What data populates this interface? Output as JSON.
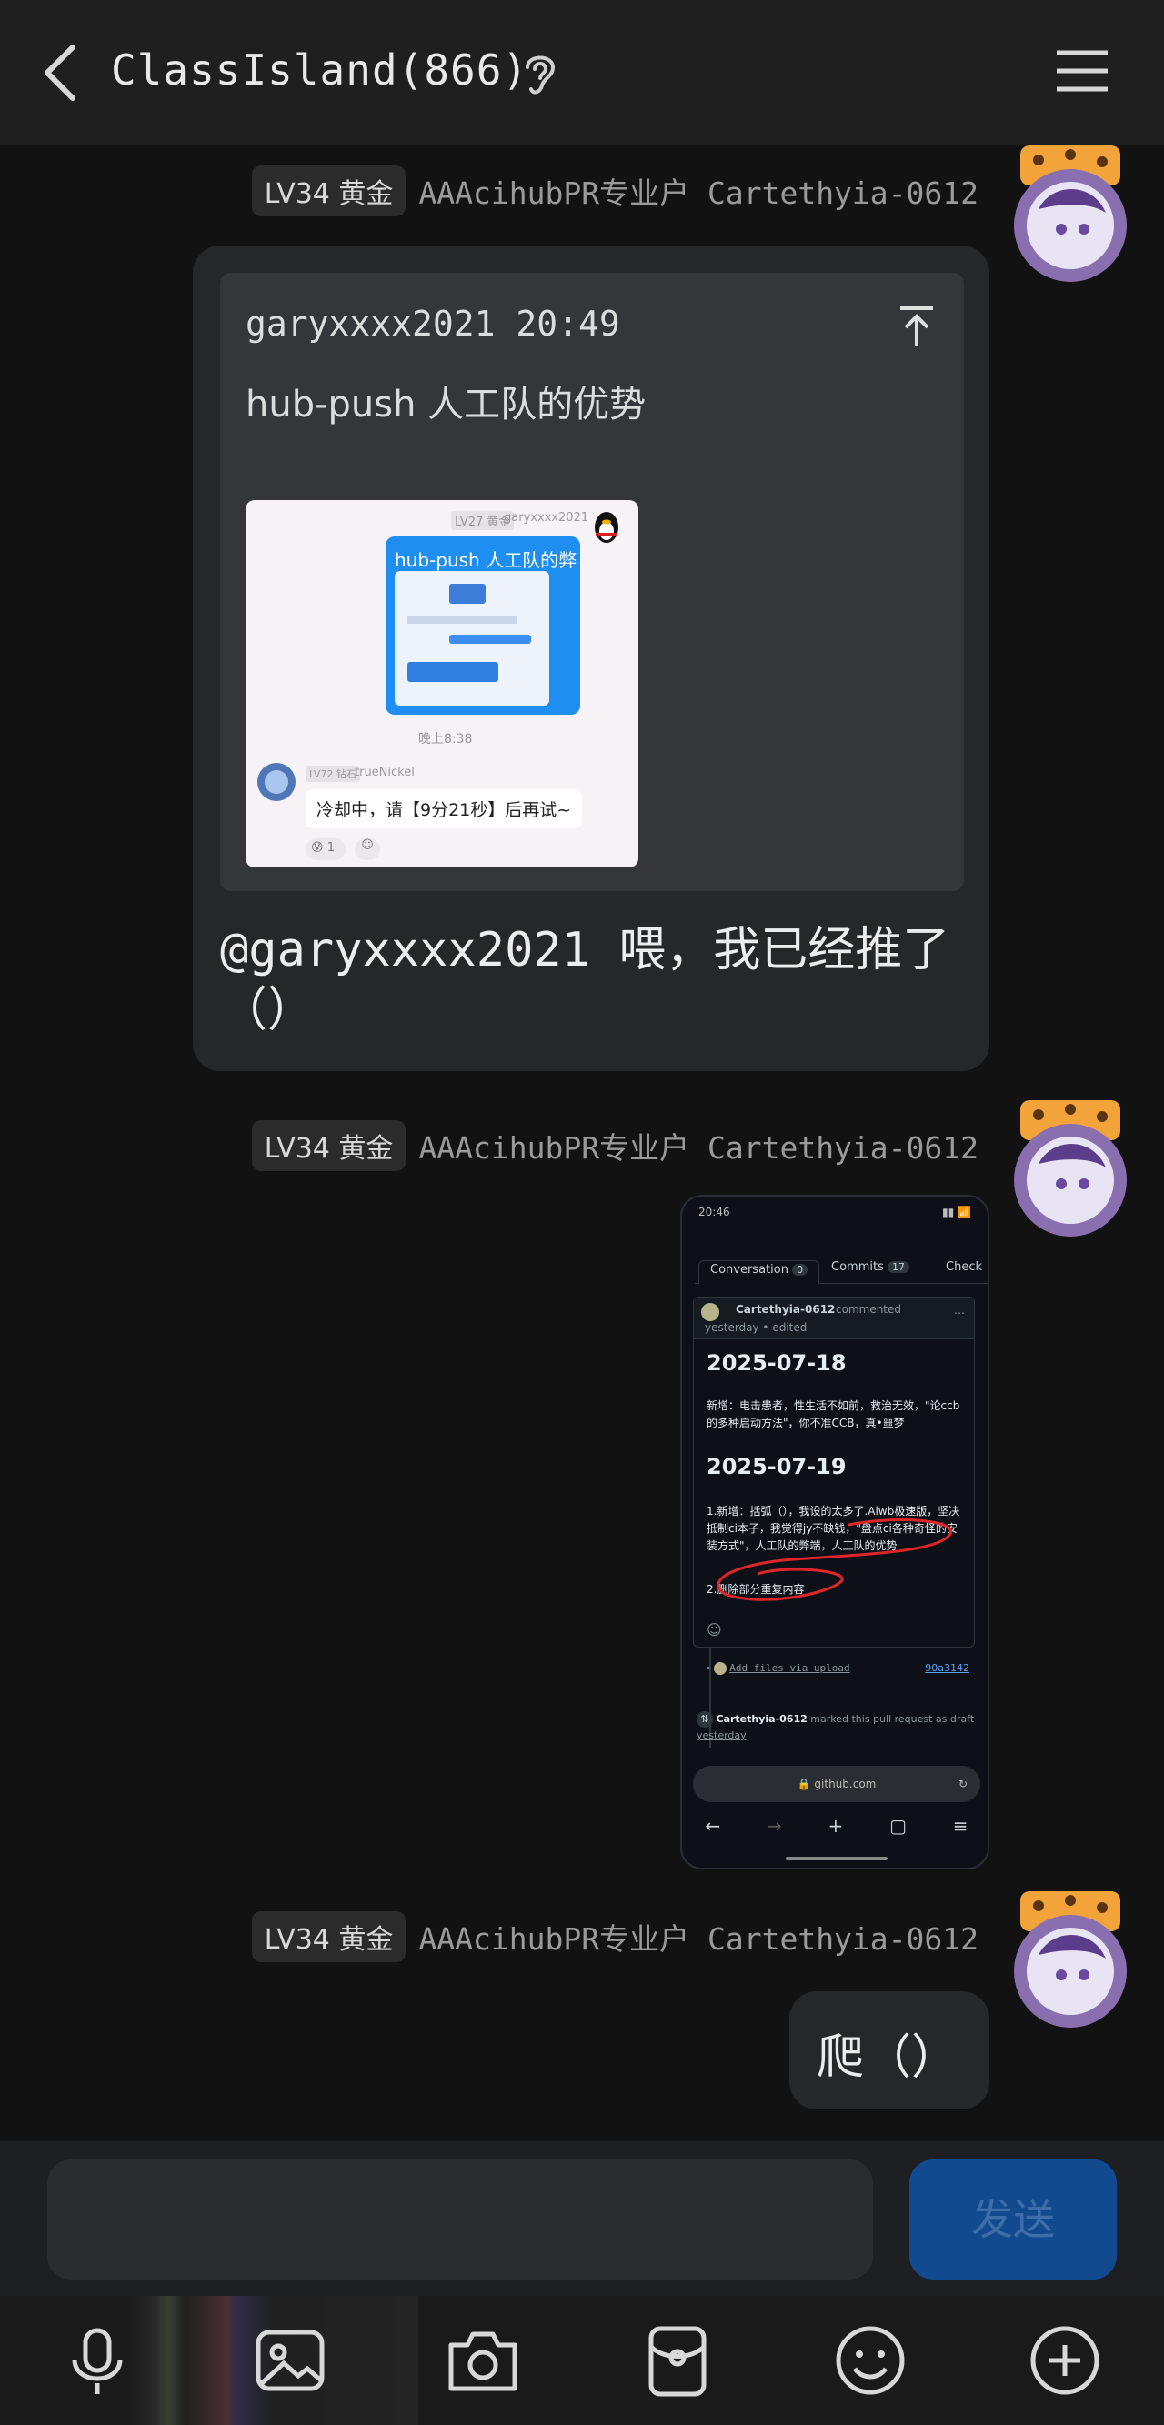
{
  "header": {
    "title": "ClassIsland(866)",
    "back_icon": "chevron-left-icon",
    "ear_icon": "ear-icon",
    "menu_icon": "hamburger-menu-icon"
  },
  "messages": [
    {
      "badge": "LV34 黄金",
      "sender": "AAAcihubPR专业户 Cartethyia-0612",
      "quote": {
        "author_time": "garyxxxx2021 20:49",
        "text": "hub-push 人工队的优势",
        "thumb": {
          "badge": "LV27 黄金",
          "sender": "garyxxxx2021",
          "card_title": "hub-push 人工队的弊端",
          "time": "晚上8:38",
          "reply_badge": "LV72 钻石",
          "reply_sender": "trueNickel",
          "reply_text": "冷却中，请【9分21秒】后再试~",
          "reaction_count": "1"
        }
      },
      "text": "@garyxxxx2021 喂，我已经推了（）"
    },
    {
      "badge": "LV34 黄金",
      "sender": "AAAcihubPR专业户 Cartethyia-0612",
      "screenshot": {
        "status_time": "20:46",
        "tab_conversation": "Conversation",
        "tab_conversation_count": "0",
        "tab_commits": "Commits",
        "tab_commits_count": "17",
        "tab_checks": "Check",
        "comment_author": "Cartethyia-0612",
        "comment_action": "commented",
        "comment_meta": "yesterday • edited",
        "h1": "2025-07-18",
        "p1": "新增：电击患者，性生活不如前，救治无效，\"论ccb的多种启动方法\"，你不准CCB，真•噩梦",
        "h2": "2025-07-19",
        "p2": "1.新增：括弧（），我设的太多了.Aiwb极速版，坚决抵制ci本子，我觉得jy不缺钱，\"盘点ci各种奇怪的安装方式\"，人工队的弊端，人工队的优势",
        "p3": "2.删除部分重复内容",
        "commit_text": "Add files via upload",
        "commit_hash": "90a3142",
        "event_author": "Cartethyia-0612",
        "event_text": "marked this pull request as draft",
        "event_time": "yesterday",
        "url": "github.com"
      }
    },
    {
      "badge": "LV34 黄金",
      "sender": "AAAcihubPR专业户 Cartethyia-0612",
      "text": "爬（）"
    }
  ],
  "input": {
    "placeholder": "",
    "send_label": "发送"
  },
  "toolbar": [
    "microphone-icon",
    "image-icon",
    "camera-icon",
    "red-packet-icon",
    "emoji-icon",
    "plus-circle-icon"
  ],
  "colors": {
    "background": "#121212",
    "bubble": "#262729",
    "send": "#114a8e"
  }
}
